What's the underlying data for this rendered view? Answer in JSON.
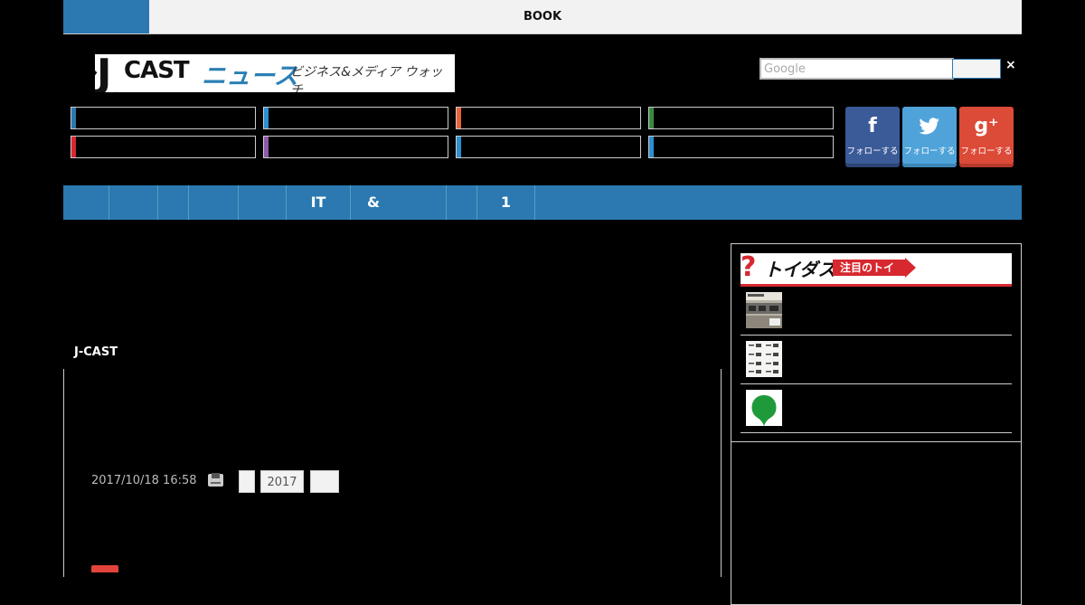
{
  "topbar": {
    "book_label": "BOOK"
  },
  "logo": {
    "j": "J",
    "cast": "CAST",
    "news": "ニュース",
    "tagline": "ビジネス&メディア ウォッチ"
  },
  "search": {
    "placeholder": "Google",
    "close": "×"
  },
  "categories": [
    {
      "color": "#2b79b0"
    },
    {
      "color": "#2b8fd0"
    },
    {
      "color": "#e8623a"
    },
    {
      "color": "#3a8a3e"
    },
    {
      "color": "#d7282f"
    },
    {
      "color": "#8e5aa8"
    },
    {
      "color": "#2b8fd0"
    },
    {
      "color": "#2b8fd0"
    }
  ],
  "social": [
    {
      "icon": "facebook-icon",
      "glyph": "f",
      "label": "フォローする",
      "color": "#3b5a98",
      "shade": "#2b4475"
    },
    {
      "icon": "twitter-icon",
      "glyph": "🐦",
      "label": "フォローする",
      "color": "#4fa3d9",
      "shade": "#3b86b6"
    },
    {
      "icon": "googleplus-icon",
      "glyph": "g⁺",
      "label": "フォローする",
      "color": "#dc4a38",
      "shade": "#b53a2b"
    }
  ],
  "nav": {
    "items": [
      "",
      "",
      "",
      "",
      "",
      "IT",
      "&",
      "",
      "1"
    ]
  },
  "main": {
    "source_label": "J-CAST",
    "date": "2017/10/18 16:58",
    "tags": [
      "",
      "2017",
      ""
    ]
  },
  "sidebar": {
    "banner": {
      "q": "?",
      "name": "トイダス",
      "badge": "注目のトイ"
    }
  },
  "colors": {
    "accent": "#2b79b0",
    "toidas_red": "#d7282f"
  }
}
